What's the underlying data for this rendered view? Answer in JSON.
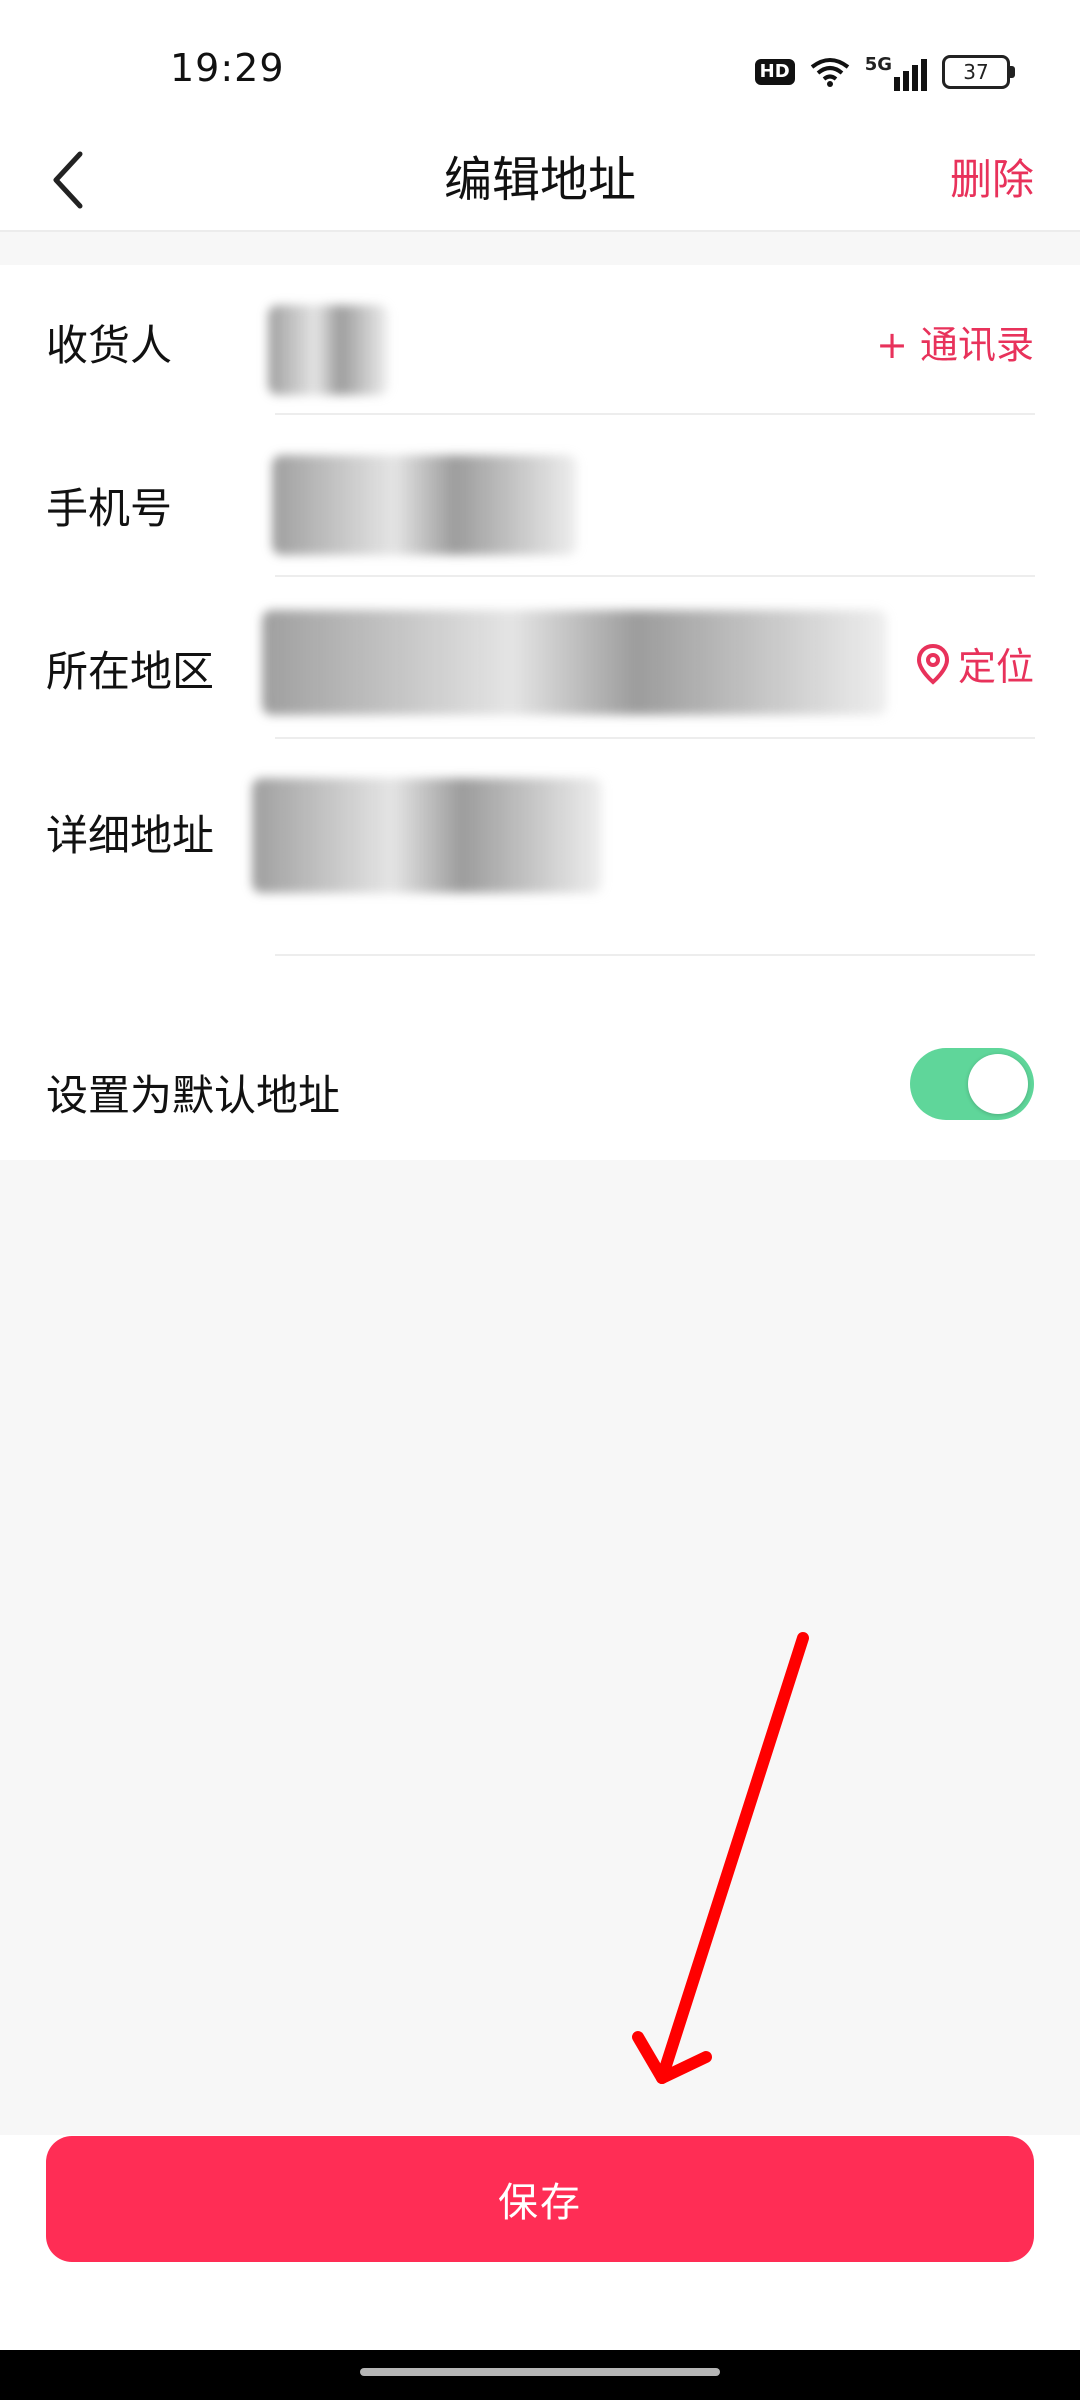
{
  "status_bar": {
    "time": "19:29",
    "network": "5G",
    "hd": "HD",
    "battery": "37"
  },
  "header": {
    "title": "编辑地址",
    "delete_label": "删除",
    "back_icon": "chevron-left-icon"
  },
  "form": {
    "recipient_label": "收货人",
    "contacts_link": "+ 通讯录",
    "phone_label": "手机号",
    "region_label": "所在地区",
    "locate_label": "定位",
    "detail_label": "详细地址",
    "default_label": "设置为默认地址",
    "default_enabled": true
  },
  "save_label": "保存",
  "colors": {
    "accent": "#ff2d55",
    "link": "#e8325b",
    "toggle_on": "#5fd69a",
    "annotation_arrow": "#ff0000"
  }
}
